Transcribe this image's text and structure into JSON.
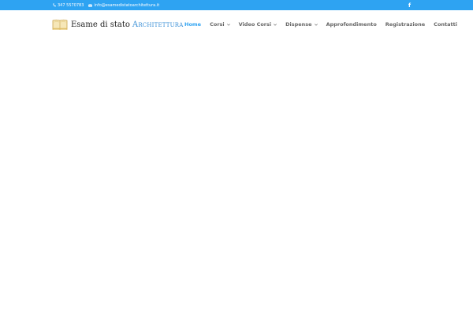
{
  "topbar": {
    "phone": "347 5570783",
    "email": "info@esamedistatoarchitettura.it",
    "phone_icon": "phone-icon",
    "email_icon": "envelope-icon",
    "social_icon": "facebook-icon",
    "social_label": "f",
    "background_color": "#2ea3f2"
  },
  "logo": {
    "part1": "Esame di stato",
    "part2": "Architettura",
    "icon": "book-logo-icon"
  },
  "nav": {
    "items": [
      {
        "label": "Home",
        "active": true,
        "dropdown": false
      },
      {
        "label": "Corsi",
        "active": false,
        "dropdown": true
      },
      {
        "label": "Video Corsi",
        "active": false,
        "dropdown": true
      },
      {
        "label": "Dispense",
        "active": false,
        "dropdown": true
      },
      {
        "label": "Approfondimento",
        "active": false,
        "dropdown": false
      },
      {
        "label": "Registrazione",
        "active": false,
        "dropdown": false
      },
      {
        "label": "Contatti",
        "active": false,
        "dropdown": false
      }
    ],
    "accent_color": "#2ea3f2",
    "text_color": "#666666"
  }
}
